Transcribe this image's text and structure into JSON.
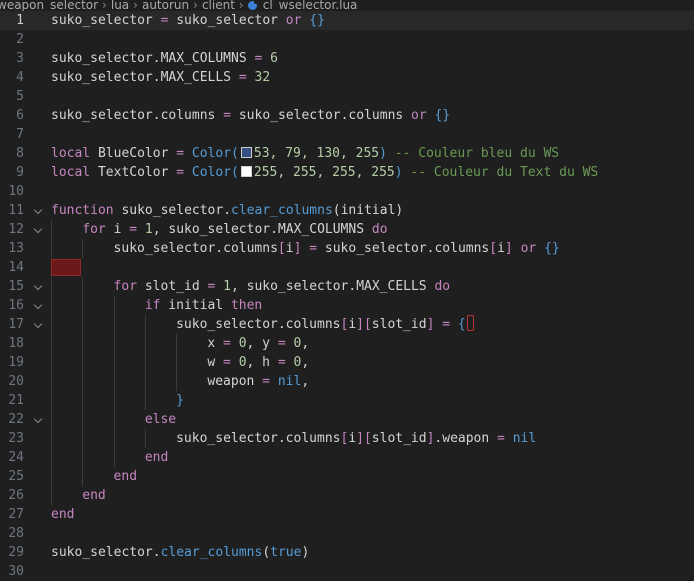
{
  "breadcrumb": {
    "parts": [
      "weapon_selector",
      "lua",
      "autorun",
      "client"
    ],
    "file": "cl_wselector.lua"
  },
  "colors": {
    "blue_swatch": "#354f82",
    "text_swatch": "#ffffff",
    "error_mark": "#6b1818"
  },
  "lines": [
    {
      "num": "1",
      "fold": false,
      "current": true,
      "indent": 0,
      "tokens": [
        {
          "t": "suko_selector",
          "c": "op"
        },
        {
          "t": " = ",
          "c": "k"
        },
        {
          "t": "suko_selector",
          "c": "op"
        },
        {
          "t": " or ",
          "c": "k"
        },
        {
          "t": "{}",
          "c": "kw"
        }
      ]
    },
    {
      "num": "2",
      "fold": false,
      "indent": 0,
      "tokens": []
    },
    {
      "num": "3",
      "fold": false,
      "indent": 0,
      "tokens": [
        {
          "t": "suko_selector.MAX_COLUMNS",
          "c": "op"
        },
        {
          "t": " = ",
          "c": "k"
        },
        {
          "t": "6",
          "c": "num"
        }
      ]
    },
    {
      "num": "4",
      "fold": false,
      "indent": 0,
      "tokens": [
        {
          "t": "suko_selector.MAX_CELLS",
          "c": "op"
        },
        {
          "t": " = ",
          "c": "k"
        },
        {
          "t": "32",
          "c": "num"
        }
      ]
    },
    {
      "num": "5",
      "fold": false,
      "indent": 0,
      "tokens": []
    },
    {
      "num": "6",
      "fold": false,
      "indent": 0,
      "tokens": [
        {
          "t": "suko_selector.columns",
          "c": "op"
        },
        {
          "t": " = ",
          "c": "k"
        },
        {
          "t": "suko_selector.columns",
          "c": "op"
        },
        {
          "t": " or ",
          "c": "k"
        },
        {
          "t": "{}",
          "c": "kw"
        }
      ]
    },
    {
      "num": "7",
      "fold": false,
      "indent": 0,
      "tokens": []
    },
    {
      "num": "8",
      "fold": false,
      "indent": 0,
      "tokens": [
        {
          "t": "local",
          "c": "k"
        },
        {
          "t": " BlueColor",
          "c": "op"
        },
        {
          "t": " = ",
          "c": "k"
        },
        {
          "t": "Color(",
          "c": "kw"
        },
        {
          "t": "",
          "c": "swatch-blue"
        },
        {
          "t": "53, 79, 130, 255",
          "c": "num"
        },
        {
          "t": ")",
          "c": "kw"
        },
        {
          "t": " -- Couleur bleu du WS",
          "c": "cm"
        }
      ]
    },
    {
      "num": "9",
      "fold": false,
      "indent": 0,
      "tokens": [
        {
          "t": "local",
          "c": "k"
        },
        {
          "t": " TextColor",
          "c": "op"
        },
        {
          "t": " = ",
          "c": "k"
        },
        {
          "t": "Color(",
          "c": "kw"
        },
        {
          "t": "",
          "c": "swatch-white"
        },
        {
          "t": "255, 255, 255, 255",
          "c": "num"
        },
        {
          "t": ")",
          "c": "kw"
        },
        {
          "t": " -- Couleur du Text du WS",
          "c": "cm"
        }
      ]
    },
    {
      "num": "10",
      "fold": false,
      "indent": 0,
      "tokens": []
    },
    {
      "num": "11",
      "fold": true,
      "indent": 0,
      "tokens": [
        {
          "t": "function",
          "c": "k"
        },
        {
          "t": " suko_selector.",
          "c": "op"
        },
        {
          "t": "clear_columns",
          "c": "kw"
        },
        {
          "t": "(initial)",
          "c": "op"
        }
      ]
    },
    {
      "num": "12",
      "fold": true,
      "indent": 1,
      "tokens": [
        {
          "t": "for",
          "c": "k"
        },
        {
          "t": " i",
          "c": "op"
        },
        {
          "t": " = ",
          "c": "k"
        },
        {
          "t": "1",
          "c": "num"
        },
        {
          "t": ", suko_selector.MAX_COLUMNS ",
          "c": "op"
        },
        {
          "t": "do",
          "c": "k"
        }
      ]
    },
    {
      "num": "13",
      "fold": false,
      "indent": 2,
      "tokens": [
        {
          "t": "suko_selector.columns",
          "c": "op"
        },
        {
          "t": "[",
          "c": "k"
        },
        {
          "t": "i",
          "c": "op"
        },
        {
          "t": "]",
          "c": "k"
        },
        {
          "t": " = ",
          "c": "k"
        },
        {
          "t": "suko_selector.columns",
          "c": "op"
        },
        {
          "t": "[",
          "c": "k"
        },
        {
          "t": "i",
          "c": "op"
        },
        {
          "t": "]",
          "c": "k"
        },
        {
          "t": " or ",
          "c": "k"
        },
        {
          "t": "{}",
          "c": "kw"
        }
      ]
    },
    {
      "num": "14",
      "fold": false,
      "indent": 0,
      "error": true,
      "tokens": []
    },
    {
      "num": "15",
      "fold": true,
      "indent": 2,
      "tokens": [
        {
          "t": "for",
          "c": "k"
        },
        {
          "t": " slot_id",
          "c": "op"
        },
        {
          "t": " = ",
          "c": "k"
        },
        {
          "t": "1",
          "c": "num"
        },
        {
          "t": ", suko_selector.MAX_CELLS ",
          "c": "op"
        },
        {
          "t": "do",
          "c": "k"
        }
      ]
    },
    {
      "num": "16",
      "fold": true,
      "indent": 3,
      "tokens": [
        {
          "t": "if",
          "c": "k"
        },
        {
          "t": " initial ",
          "c": "op"
        },
        {
          "t": "then",
          "c": "k"
        }
      ]
    },
    {
      "num": "17",
      "fold": true,
      "indent": 4,
      "tokens": [
        {
          "t": "suko_selector.columns",
          "c": "op"
        },
        {
          "t": "[",
          "c": "k"
        },
        {
          "t": "i",
          "c": "op"
        },
        {
          "t": "][",
          "c": "k"
        },
        {
          "t": "slot_id",
          "c": "op"
        },
        {
          "t": "]",
          "c": "k"
        },
        {
          "t": " = ",
          "c": "k"
        },
        {
          "t": "{",
          "c": "kw"
        },
        {
          "t": "",
          "c": "cursor"
        }
      ]
    },
    {
      "num": "18",
      "fold": false,
      "indent": 5,
      "tokens": [
        {
          "t": "x",
          "c": "op"
        },
        {
          "t": " = ",
          "c": "k"
        },
        {
          "t": "0",
          "c": "num"
        },
        {
          "t": ", y",
          "c": "op"
        },
        {
          "t": " = ",
          "c": "k"
        },
        {
          "t": "0",
          "c": "num"
        },
        {
          "t": ",",
          "c": "op"
        }
      ]
    },
    {
      "num": "19",
      "fold": false,
      "indent": 5,
      "tokens": [
        {
          "t": "w",
          "c": "op"
        },
        {
          "t": " = ",
          "c": "k"
        },
        {
          "t": "0",
          "c": "num"
        },
        {
          "t": ", h",
          "c": "op"
        },
        {
          "t": " = ",
          "c": "k"
        },
        {
          "t": "0",
          "c": "num"
        },
        {
          "t": ",",
          "c": "op"
        }
      ]
    },
    {
      "num": "20",
      "fold": false,
      "indent": 5,
      "tokens": [
        {
          "t": "weapon",
          "c": "op"
        },
        {
          "t": " = ",
          "c": "k"
        },
        {
          "t": "nil",
          "c": "kw"
        },
        {
          "t": ",",
          "c": "op"
        }
      ]
    },
    {
      "num": "21",
      "fold": false,
      "indent": 4,
      "tokens": [
        {
          "t": "}",
          "c": "kw"
        }
      ]
    },
    {
      "num": "22",
      "fold": true,
      "indent": 3,
      "tokens": [
        {
          "t": "else",
          "c": "k"
        }
      ]
    },
    {
      "num": "23",
      "fold": false,
      "indent": 4,
      "tokens": [
        {
          "t": "suko_selector.columns",
          "c": "op"
        },
        {
          "t": "[",
          "c": "k"
        },
        {
          "t": "i",
          "c": "op"
        },
        {
          "t": "][",
          "c": "k"
        },
        {
          "t": "slot_id",
          "c": "op"
        },
        {
          "t": "]",
          "c": "k"
        },
        {
          "t": ".weapon",
          "c": "op"
        },
        {
          "t": " = ",
          "c": "k"
        },
        {
          "t": "nil",
          "c": "kw"
        }
      ]
    },
    {
      "num": "24",
      "fold": false,
      "indent": 3,
      "tokens": [
        {
          "t": "end",
          "c": "k"
        }
      ]
    },
    {
      "num": "25",
      "fold": false,
      "indent": 2,
      "tokens": [
        {
          "t": "end",
          "c": "k"
        }
      ]
    },
    {
      "num": "26",
      "fold": false,
      "indent": 1,
      "tokens": [
        {
          "t": "end",
          "c": "k"
        }
      ]
    },
    {
      "num": "27",
      "fold": false,
      "indent": 0,
      "tokens": [
        {
          "t": "end",
          "c": "k"
        }
      ]
    },
    {
      "num": "28",
      "fold": false,
      "indent": 0,
      "tokens": []
    },
    {
      "num": "29",
      "fold": false,
      "indent": 0,
      "tokens": [
        {
          "t": "suko_selector.",
          "c": "op"
        },
        {
          "t": "clear_columns",
          "c": "kw"
        },
        {
          "t": "(",
          "c": "op"
        },
        {
          "t": "true",
          "c": "kw"
        },
        {
          "t": ")",
          "c": "op"
        }
      ]
    },
    {
      "num": "30",
      "fold": false,
      "indent": 0,
      "tokens": []
    }
  ]
}
